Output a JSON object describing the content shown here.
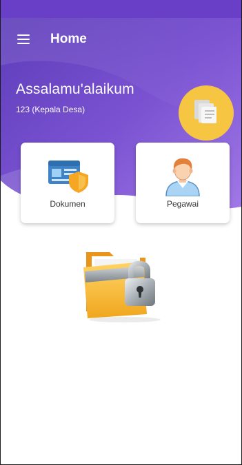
{
  "appbar": {
    "title": "Home",
    "menu_icon": "hamburger-menu-icon"
  },
  "header": {
    "greeting": "Assalamu'alaikum",
    "user_role": "123 (Kepala Desa)",
    "badge_icon": "documents-icon"
  },
  "cards": [
    {
      "label": "Dokumen",
      "icon": "document-shield-icon"
    },
    {
      "label": "Pegawai",
      "icon": "employee-icon"
    }
  ],
  "illustration": {
    "icon": "locked-folder-icon"
  },
  "colors": {
    "primary": "#6a3fc8",
    "hero_gradient_start": "#5b3bb8",
    "hero_gradient_end": "#9a6ee0",
    "badge": "#f6c642",
    "card_bg": "#ffffff"
  }
}
